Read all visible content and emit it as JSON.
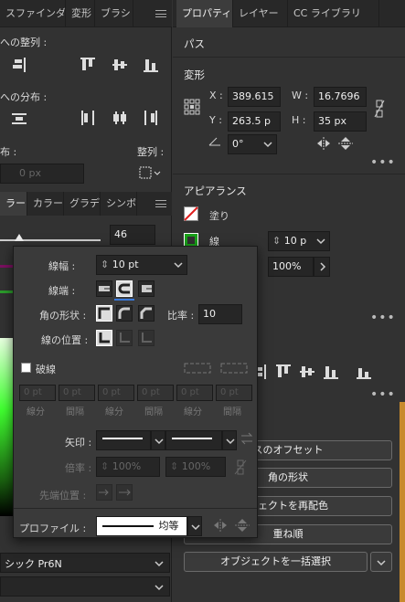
{
  "left_panel": {
    "tabs": [
      "スファインダー",
      "変形",
      "ブラシ"
    ],
    "align_objects_label": "への整列 :",
    "distribute_objects_label": "への分布 :",
    "distribute_spacing_label": "布 :",
    "align_to_label": "整列 :",
    "spacing_value": "0 px",
    "color_tabs": [
      "ラー",
      "カラー",
      "グラデ",
      "シンボ"
    ],
    "slider_value": "46",
    "font_name": "シック Pr6N"
  },
  "stroke_popup": {
    "weight_label": "線幅 :",
    "weight_value": "10 pt",
    "cap_label": "線端 :",
    "corner_label": "角の形状 :",
    "limit_label": "比率 :",
    "limit_value": "10",
    "align_label": "線の位置 :",
    "dashed_label": "破線",
    "dash_cells": [
      {
        "value": "0 pt",
        "label": "線分"
      },
      {
        "value": "0 pt",
        "label": "間隔"
      },
      {
        "value": "0 pt",
        "label": "線分"
      },
      {
        "value": "0 pt",
        "label": "間隔"
      },
      {
        "value": "0 pt",
        "label": "線分"
      },
      {
        "value": "0 pt",
        "label": "間隔"
      }
    ],
    "arrow_label": "矢印 :",
    "scale_label": "倍率 :",
    "scale_value_1": "100%",
    "scale_value_2": "100%",
    "tip_label": "先端位置 :",
    "profile_label": "プロファイル :",
    "profile_value": "均等"
  },
  "right_panel": {
    "tabs": [
      "プロパティ",
      "レイヤー",
      "CC ライブラリ"
    ],
    "path_title": "パス",
    "transform_title": "変形",
    "x_label": "X :",
    "x_value": "389.615",
    "y_label": "Y :",
    "y_value": "263.5 p",
    "w_label": "W :",
    "w_value": "16.7696",
    "h_label": "H :",
    "h_value": "35 px",
    "angle_value": "0°",
    "appearance_title": "アピアランス",
    "fill_label": "塗り",
    "stroke_label": "線",
    "stroke_weight": "10 p",
    "opacity_value": "100%",
    "buttons": {
      "offset": "スのオフセット",
      "corners": "角の形状",
      "recolor": "ジェクトを再配色",
      "arrange": "重ね順",
      "select_all": "オブジェクトを一括選択"
    }
  }
}
